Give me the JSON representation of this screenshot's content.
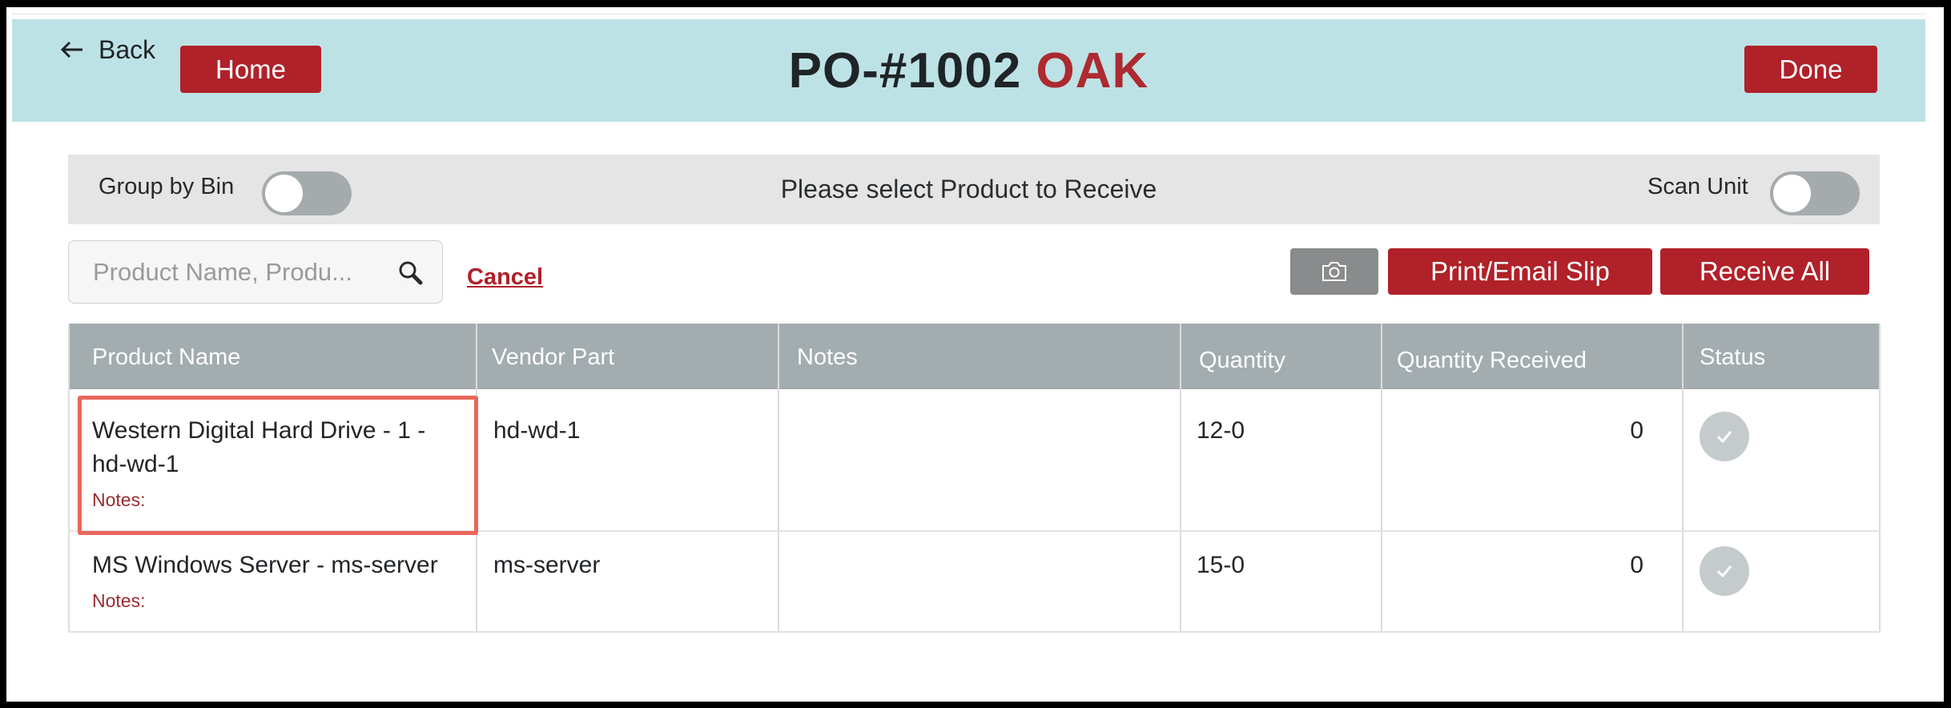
{
  "header": {
    "back_label": "Back",
    "home_label": "Home",
    "done_label": "Done",
    "po_number": "PO-#1002",
    "location": "OAK"
  },
  "toolbar": {
    "group_by_bin_label": "Group by Bin",
    "group_by_bin_on": false,
    "prompt": "Please select Product to Receive",
    "scan_unit_label": "Scan Unit",
    "scan_unit_on": false
  },
  "search": {
    "placeholder": "Product Name, Produ...",
    "value": "",
    "cancel_label": "Cancel"
  },
  "actions": {
    "camera_icon": "camera-icon",
    "print_label": "Print/Email Slip",
    "receive_all_label": "Receive All"
  },
  "table": {
    "columns": [
      "Product Name",
      "Vendor Part",
      "Notes",
      "Quantity",
      "Quantity Received",
      "Status"
    ],
    "rows": [
      {
        "product_line1": "Western Digital Hard Drive - 1 -",
        "product_line2": "hd-wd-1",
        "notes_label": "Notes:",
        "vendor_part": "hd-wd-1",
        "notes": "",
        "quantity": "12-0",
        "quantity_received": "0",
        "status_icon": "check-icon",
        "selected": true
      },
      {
        "product_line1": "MS Windows Server - ms-server",
        "product_line2": "",
        "notes_label": "Notes:",
        "vendor_part": "ms-server",
        "notes": "",
        "quantity": "15-0",
        "quantity_received": "0",
        "status_icon": "check-icon",
        "selected": false
      }
    ]
  },
  "colors": {
    "header_bg": "#bde2e5",
    "accent_red": "#b02129",
    "table_header_bg": "#a3acaf",
    "selection_outline": "#e9675c"
  }
}
